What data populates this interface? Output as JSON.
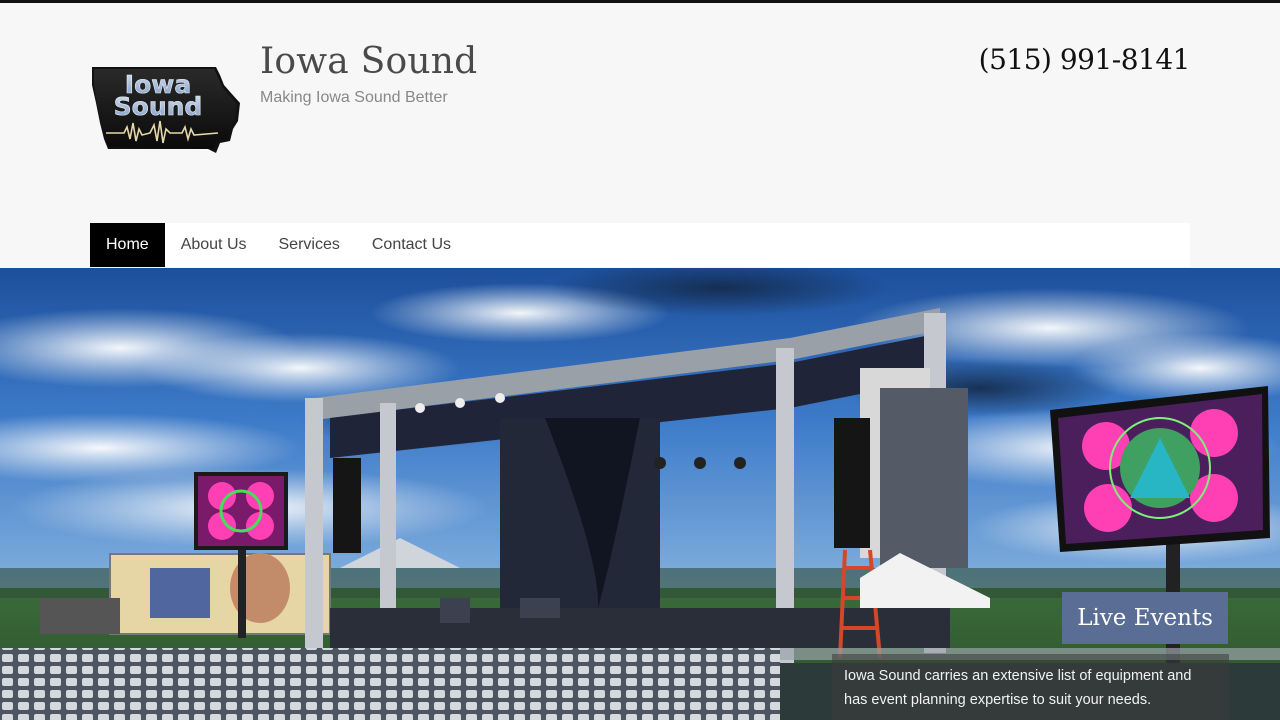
{
  "site": {
    "title": "Iowa Sound",
    "tagline": "Making Iowa Sound Better",
    "phone": "(515) 991-8141",
    "logo_text_line1": "Iowa",
    "logo_text_line2": "Sound"
  },
  "nav": {
    "items": [
      {
        "label": "Home",
        "active": true
      },
      {
        "label": "About Us",
        "active": false
      },
      {
        "label": "Services",
        "active": false
      },
      {
        "label": "Contact Us",
        "active": false
      }
    ]
  },
  "slider": {
    "caption_title": "Live Events",
    "caption_text": "Iowa Sound carries an extensive list of equipment and has event planning expertise to suit your needs."
  },
  "colors": {
    "caption_bg": "#5a6d94",
    "nav_active_bg": "#000000",
    "header_bg": "#f7f7f7"
  }
}
